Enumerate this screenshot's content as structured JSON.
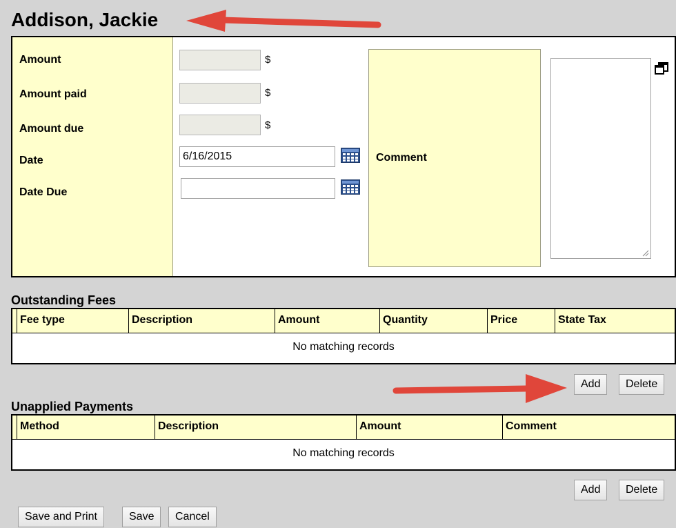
{
  "header": {
    "title": "Addison, Jackie"
  },
  "form": {
    "amount_label": "Amount",
    "amount_paid_label": "Amount paid",
    "amount_due_label": "Amount due",
    "date_label": "Date",
    "date_due_label": "Date Due",
    "currency_symbol": "$",
    "amount_value": "",
    "amount_paid_value": "",
    "amount_due_value": "",
    "date_value": "6/16/2015",
    "date_due_value": "",
    "comment_label": "Comment",
    "comment_value": ""
  },
  "outstanding_fees": {
    "title": "Outstanding Fees",
    "columns": [
      "Fee type",
      "Description",
      "Amount",
      "Quantity",
      "Price",
      "State Tax"
    ],
    "empty_text": "No matching records",
    "add_label": "Add",
    "delete_label": "Delete"
  },
  "unapplied_payments": {
    "title": "Unapplied Payments",
    "columns": [
      "Method",
      "Description",
      "Amount",
      "Comment"
    ],
    "empty_text": "No matching records",
    "add_label": "Add",
    "delete_label": "Delete"
  },
  "footer": {
    "save_print_label": "Save and Print",
    "save_label": "Save",
    "cancel_label": "Cancel"
  },
  "icons": {
    "calendar": "calendar-icon",
    "restore": "restore-window-icon"
  },
  "colors": {
    "label_bg": "#ffffcc",
    "page_bg": "#d4d4d4",
    "arrow": "#e0463a"
  }
}
